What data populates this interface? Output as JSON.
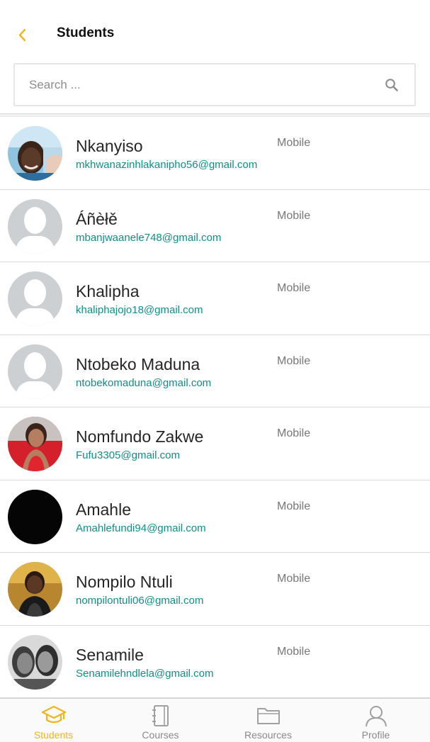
{
  "header": {
    "title": "Students",
    "back_icon": "chevron-left-icon",
    "accent_color": "#f2b51c"
  },
  "search": {
    "placeholder": "Search ...",
    "value": "",
    "icon": "search-icon"
  },
  "students": [
    {
      "name": "Nkanyiso",
      "email": "mkhwanazinhlakanipho56@gmail.com",
      "label": "Mobile",
      "avatar": "photo"
    },
    {
      "name": "Áñèłě",
      "email": "mbanjwaanele748@gmail.com",
      "label": "Mobile",
      "avatar": "placeholder"
    },
    {
      "name": "Khalipha",
      "email": "khaliphajojo18@gmail.com",
      "label": "Mobile",
      "avatar": "placeholder"
    },
    {
      "name": "Ntobeko Maduna",
      "email": "ntobekomaduna@gmail.com",
      "label": "Mobile",
      "avatar": "placeholder"
    },
    {
      "name": "Nomfundo Zakwe",
      "email": "Fufu3305@gmail.com",
      "label": "Mobile",
      "avatar": "photo"
    },
    {
      "name": "Amahle",
      "email": "Amahlefundi94@gmail.com",
      "label": "Mobile",
      "avatar": "photo"
    },
    {
      "name": "Nompilo Ntuli",
      "email": "nompilontuli06@gmail.com",
      "label": "Mobile",
      "avatar": "photo"
    },
    {
      "name": "Senamile",
      "email": "Senamilehndlela@gmail.com",
      "label": "Mobile",
      "avatar": "photo"
    }
  ],
  "nav": [
    {
      "label": "Students",
      "icon": "graduation-cap-icon",
      "active": true
    },
    {
      "label": "Courses",
      "icon": "notebook-icon",
      "active": false
    },
    {
      "label": "Resources",
      "icon": "folder-icon",
      "active": false
    },
    {
      "label": "Profile",
      "icon": "user-icon",
      "active": false
    }
  ]
}
